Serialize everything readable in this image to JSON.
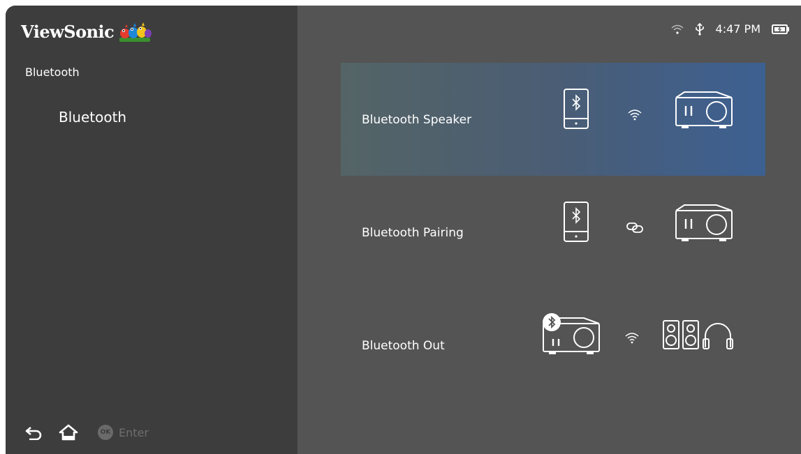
{
  "brand": {
    "name": "ViewSonic"
  },
  "sidebar": {
    "breadcrumb": "Bluetooth",
    "items": [
      {
        "label": "Bluetooth"
      }
    ]
  },
  "footer": {
    "ok_badge": "OK",
    "enter_label": "Enter"
  },
  "status_bar": {
    "time": "4:47 PM",
    "icons": [
      "wifi-icon",
      "usb-icon",
      "battery-icon"
    ]
  },
  "options": [
    {
      "label": "Bluetooth Speaker",
      "selected": true,
      "icons": [
        "phone-bluetooth-icon",
        "wireless-icon",
        "projector-icon"
      ]
    },
    {
      "label": "Bluetooth Pairing",
      "selected": false,
      "icons": [
        "phone-bluetooth-icon",
        "link-icon",
        "projector-icon"
      ]
    },
    {
      "label": "Bluetooth Out",
      "selected": false,
      "icons": [
        "projector-bluetooth-icon",
        "wireless-icon",
        "speakers-icon",
        "headphones-icon"
      ]
    }
  ],
  "colors": {
    "sidebar_bg": "#3d3d3d",
    "panel_bg": "#545454",
    "highlight_start": "#546466",
    "highlight_end": "#3d6092"
  }
}
